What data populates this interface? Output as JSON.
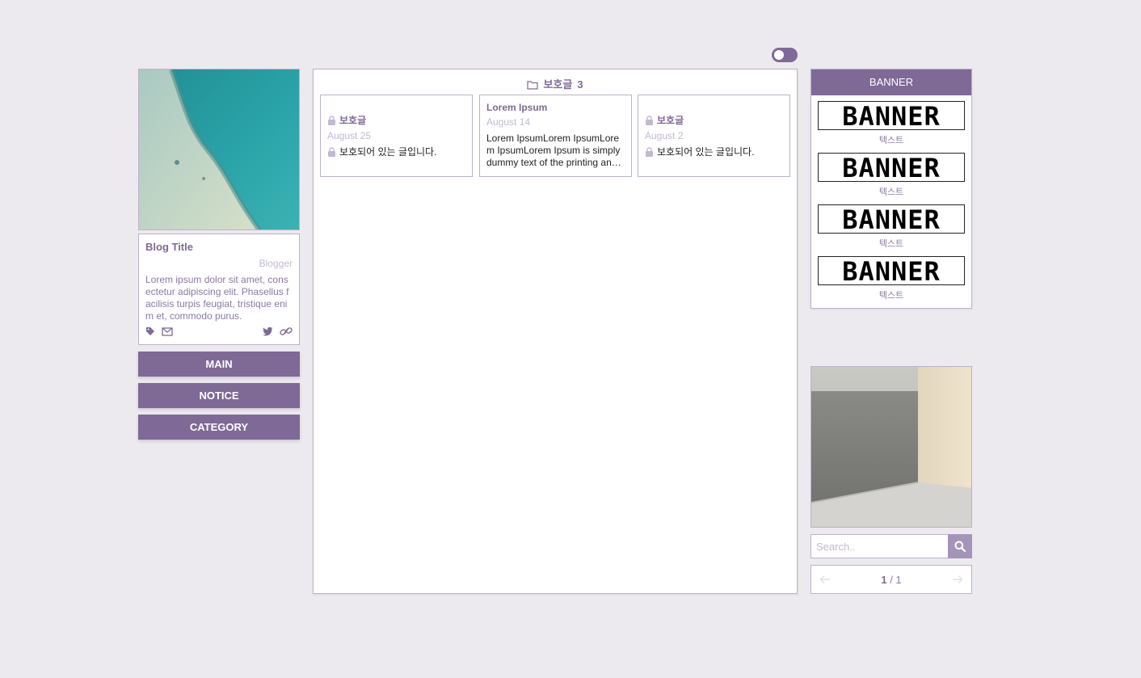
{
  "theme": {
    "accent": "#7f6996",
    "light": "#c3b9d0",
    "background": "#edeaef"
  },
  "profile": {
    "title": "Blog Title",
    "author": "Blogger",
    "description": "Lorem ipsum dolor sit amet, consectetur adipiscing elit. Phasellus facilisis turpis feugiat, tristique enim et, commodo purus.",
    "icons_left": [
      "tag-icon",
      "mail-icon"
    ],
    "icons_right": [
      "twitter-icon",
      "link-icon"
    ]
  },
  "nav": {
    "main": "MAIN",
    "notice": "NOTICE",
    "category": "CATEGORY"
  },
  "folder": {
    "name": "보호글",
    "count": "3",
    "icon": "folder-icon"
  },
  "posts": [
    {
      "title": "보호글",
      "date": "August 25",
      "body": "보호되어 있는 글입니다.",
      "locked": true
    },
    {
      "title": "Lorem Ipsum",
      "date": "August 14",
      "body": "Lorem IpsumLorem IpsumLorem IpsumLorem Ipsum is simply dummy text of the printing and typesetting industry.",
      "locked": false
    },
    {
      "title": "보호글",
      "date": "August 2",
      "body": "보호되어 있는 글입니다.",
      "locked": true
    }
  ],
  "banner": {
    "header": "BANNER",
    "items": [
      {
        "image_text": "BANNER",
        "caption": "텍스트"
      },
      {
        "image_text": "BANNER",
        "caption": "텍스트"
      },
      {
        "image_text": "BANNER",
        "caption": "텍스트"
      },
      {
        "image_text": "BANNER",
        "caption": "텍스트"
      }
    ]
  },
  "search": {
    "placeholder": "Search..",
    "icon": "search-icon"
  },
  "pagination": {
    "current": "1",
    "separator": " / ",
    "total": "1"
  }
}
